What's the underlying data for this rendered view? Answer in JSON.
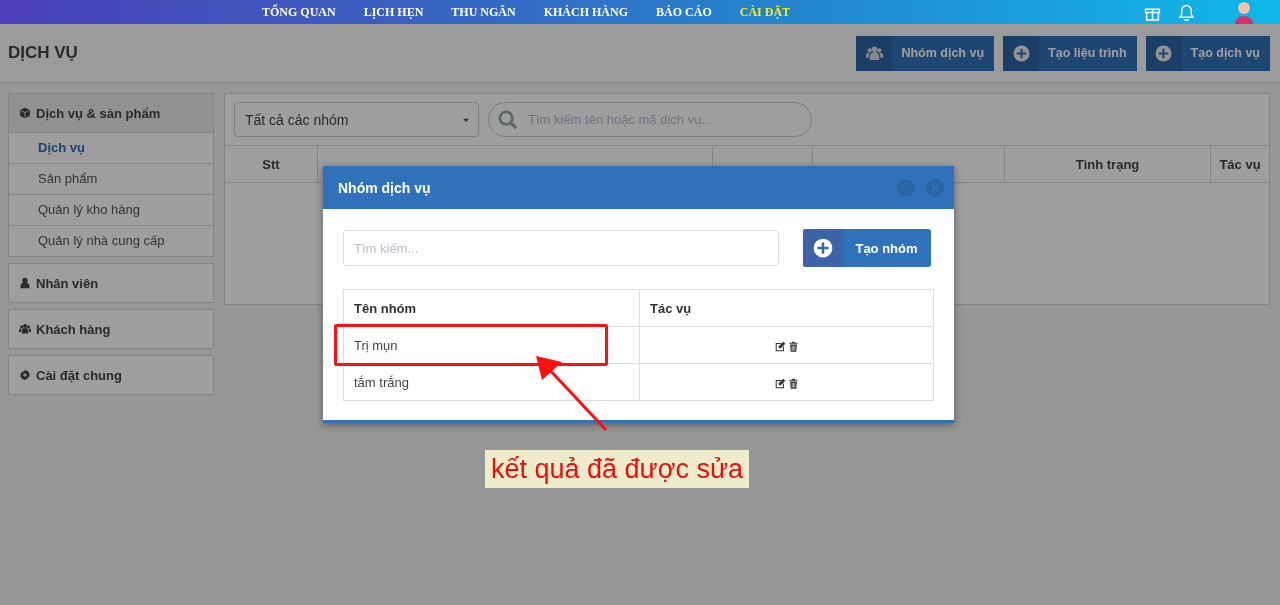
{
  "top_nav": {
    "items": [
      {
        "label": "TỔNG QUAN",
        "selected": false
      },
      {
        "label": "LỊCH HẸN",
        "selected": false
      },
      {
        "label": "THU NGÂN",
        "selected": false
      },
      {
        "label": "KHÁCH HÀNG",
        "selected": false
      },
      {
        "label": "BÁO CÁO",
        "selected": false
      },
      {
        "label": "CÀI ĐẶT",
        "selected": true
      }
    ]
  },
  "page": {
    "title": "DỊCH VỤ",
    "buttons": [
      {
        "label": "Nhóm dịch vụ",
        "kind": "group"
      },
      {
        "label": "Tạo liệu trình",
        "kind": "create"
      },
      {
        "label": "Tạo dịch vụ",
        "kind": "create"
      }
    ]
  },
  "sidebar": {
    "groups": [
      {
        "label": "Dịch vụ & sản phẩm",
        "kind": "products",
        "expanded": true,
        "items": [
          {
            "label": "Dịch vụ",
            "selected": true
          },
          {
            "label": "Sản phẩm",
            "selected": false
          },
          {
            "label": "Quản lý kho hàng",
            "selected": false
          },
          {
            "label": "Quản lý nhà cung cấp",
            "selected": false
          }
        ]
      },
      {
        "label": "Nhân viên",
        "kind": "staff",
        "expanded": false
      },
      {
        "label": "Khách hàng",
        "kind": "customers",
        "expanded": false
      },
      {
        "label": "Cài đặt chung",
        "kind": "settings",
        "expanded": false
      }
    ]
  },
  "filter": {
    "group_select": "Tất cả các nhóm",
    "search": {
      "placeholder": "Tìm kiếm tên hoặc mã dịch vụ..."
    }
  },
  "table": {
    "columns": [
      "Stt",
      "Tình trạng",
      "Tác vụ"
    ]
  },
  "modal": {
    "title": "Nhóm dịch vụ",
    "search": {
      "placeholder": "Tìm kiếm..."
    },
    "create_button": "Tạo nhóm",
    "table": {
      "columns": [
        "Tên nhóm",
        "Tác vụ"
      ],
      "rows": [
        {
          "name": "Trị mụn",
          "marked": true
        },
        {
          "name": "tắm trắng",
          "marked": false
        }
      ]
    }
  },
  "annotation": {
    "caption": "kết quả đã được sửa"
  }
}
